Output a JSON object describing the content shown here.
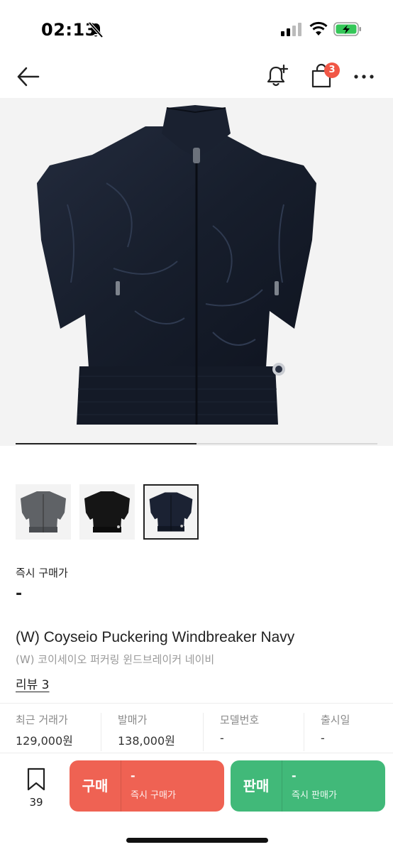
{
  "status_bar": {
    "time": "02:13",
    "icons": [
      "bell-slash-icon",
      "cellular-signal-icon",
      "wifi-icon",
      "battery-charging-icon"
    ],
    "battery_color": "#35c759"
  },
  "nav": {
    "icons": [
      "back-arrow-icon",
      "bell-plus-icon",
      "shopping-bag-icon",
      "more-icon"
    ],
    "bag_badge": "3",
    "badge_color": "#f15746"
  },
  "gallery": {
    "main_image": "navy-windbreaker-photo",
    "progress": 0.5,
    "thumbnails": [
      {
        "name": "grey-windbreaker-thumb",
        "color": "#5f6266",
        "selected": false
      },
      {
        "name": "black-windbreaker-thumb",
        "color": "#151515",
        "selected": false
      },
      {
        "name": "navy-windbreaker-thumb",
        "color": "#1b2233",
        "selected": true
      }
    ]
  },
  "price": {
    "label": "즉시 구매가",
    "value": "-"
  },
  "product": {
    "title_en": "(W) Coyseio Puckering Windbreaker Navy",
    "title_ko": "(W) 코이세이오 퍼커링 윈드브레이커 네이비",
    "review_link": "리뷰 3"
  },
  "info": [
    {
      "label": "최근 거래가",
      "value": "129,000원"
    },
    {
      "label": "발매가",
      "value": "138,000원"
    },
    {
      "label": "모델번호",
      "value": "-"
    },
    {
      "label": "출시일",
      "value": "-"
    }
  ],
  "bottom": {
    "bookmark_count": "39",
    "buy": {
      "label": "구매",
      "price": "-",
      "sub": "즉시 구매가",
      "color": "#ef6253"
    },
    "sell": {
      "label": "판매",
      "price": "-",
      "sub": "즉시 판매가",
      "color": "#41b979"
    }
  }
}
